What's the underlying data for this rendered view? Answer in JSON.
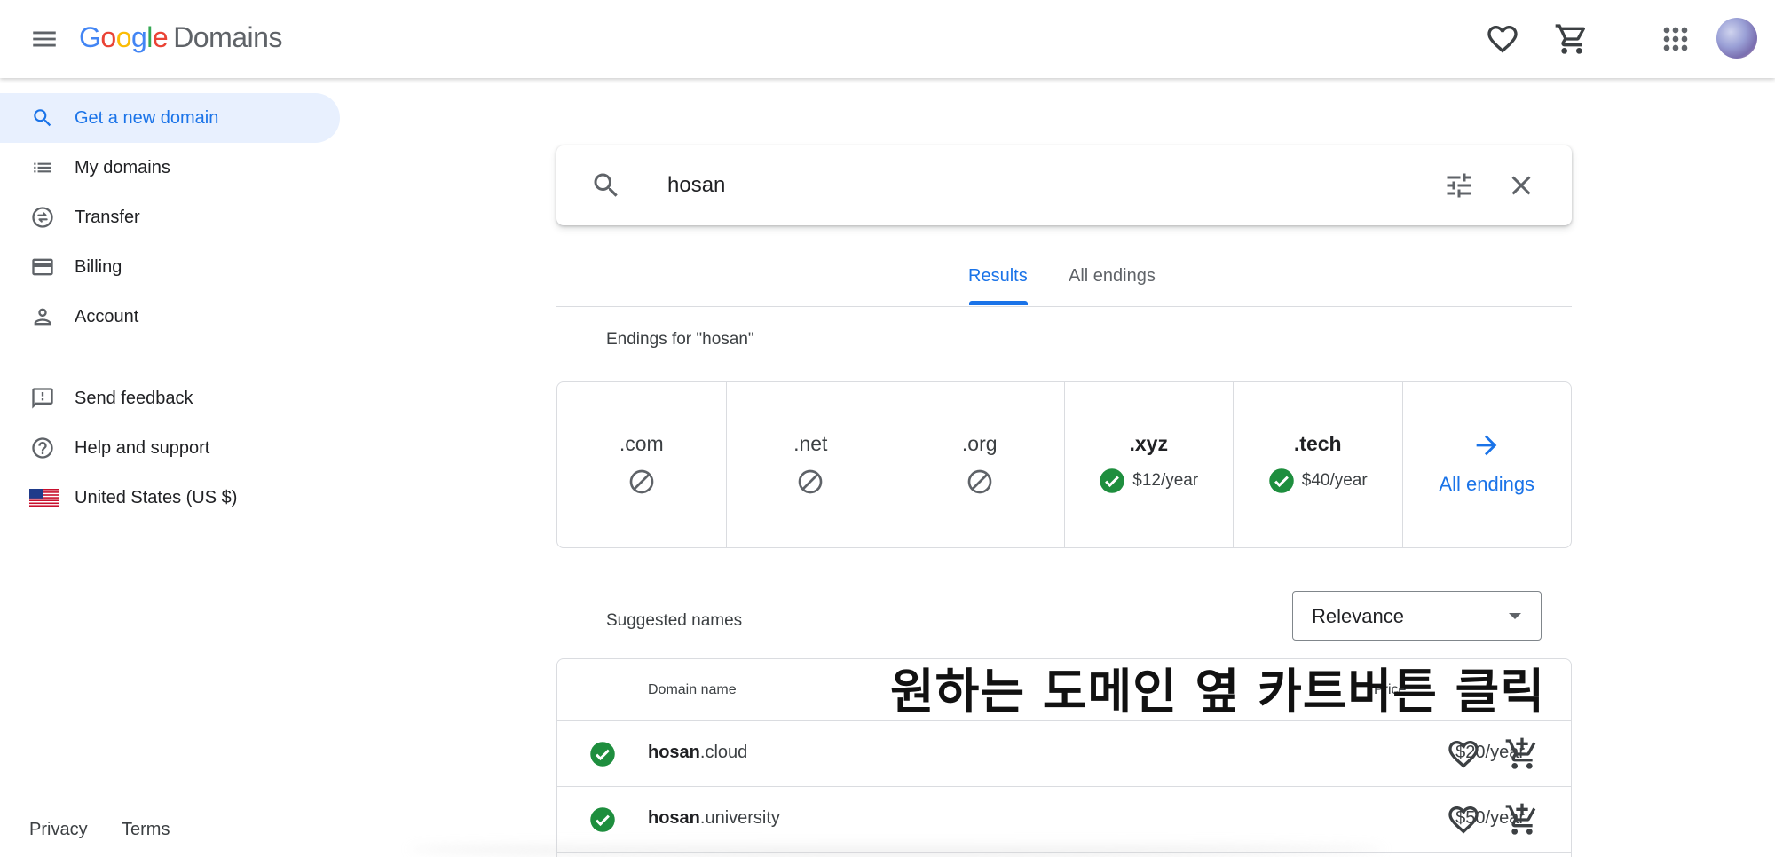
{
  "header": {
    "logo_letters": [
      "G",
      "o",
      "o",
      "g",
      "l",
      "e"
    ],
    "logo_product": "Domains"
  },
  "sidebar": {
    "items": [
      {
        "label": "Get a new domain",
        "icon": "search-icon",
        "active": true
      },
      {
        "label": "My domains",
        "icon": "list-icon"
      },
      {
        "label": "Transfer",
        "icon": "transfer-icon"
      },
      {
        "label": "Billing",
        "icon": "credit-card-icon"
      },
      {
        "label": "Account",
        "icon": "person-icon"
      }
    ],
    "secondary": [
      {
        "label": "Send feedback",
        "icon": "feedback-icon"
      },
      {
        "label": "Help and support",
        "icon": "help-icon"
      },
      {
        "label": "United States (US $)",
        "icon": "us-flag-icon"
      }
    ],
    "footer": {
      "privacy": "Privacy",
      "terms": "Terms"
    }
  },
  "search": {
    "value": "hosan"
  },
  "tabs": [
    {
      "label": "Results",
      "active": true
    },
    {
      "label": "All endings"
    }
  ],
  "endings_title": "Endings for \"hosan\"",
  "endings": [
    {
      "name": ".com",
      "available": false
    },
    {
      "name": ".net",
      "available": false
    },
    {
      "name": ".org",
      "available": false
    },
    {
      "name": ".xyz",
      "available": true,
      "price": "$12/year"
    },
    {
      "name": ".tech",
      "available": true,
      "price": "$40/year"
    }
  ],
  "all_endings_link": "All endings",
  "suggested_title": "Suggested names",
  "sort": {
    "selected": "Relevance"
  },
  "table": {
    "col_domain": "Domain name",
    "col_price": "Price",
    "rows": [
      {
        "base": "hosan",
        "tld": ".cloud",
        "price": "$20/year"
      },
      {
        "base": "hosan",
        "tld": ".university",
        "price": "$50/year"
      }
    ]
  },
  "overlay_caption": "원하는 도메인 옆 카트버튼 클릭",
  "colors": {
    "accent": "#1a73e8",
    "available": "#1e8e3e",
    "active_bg": "#e8f0fe"
  }
}
